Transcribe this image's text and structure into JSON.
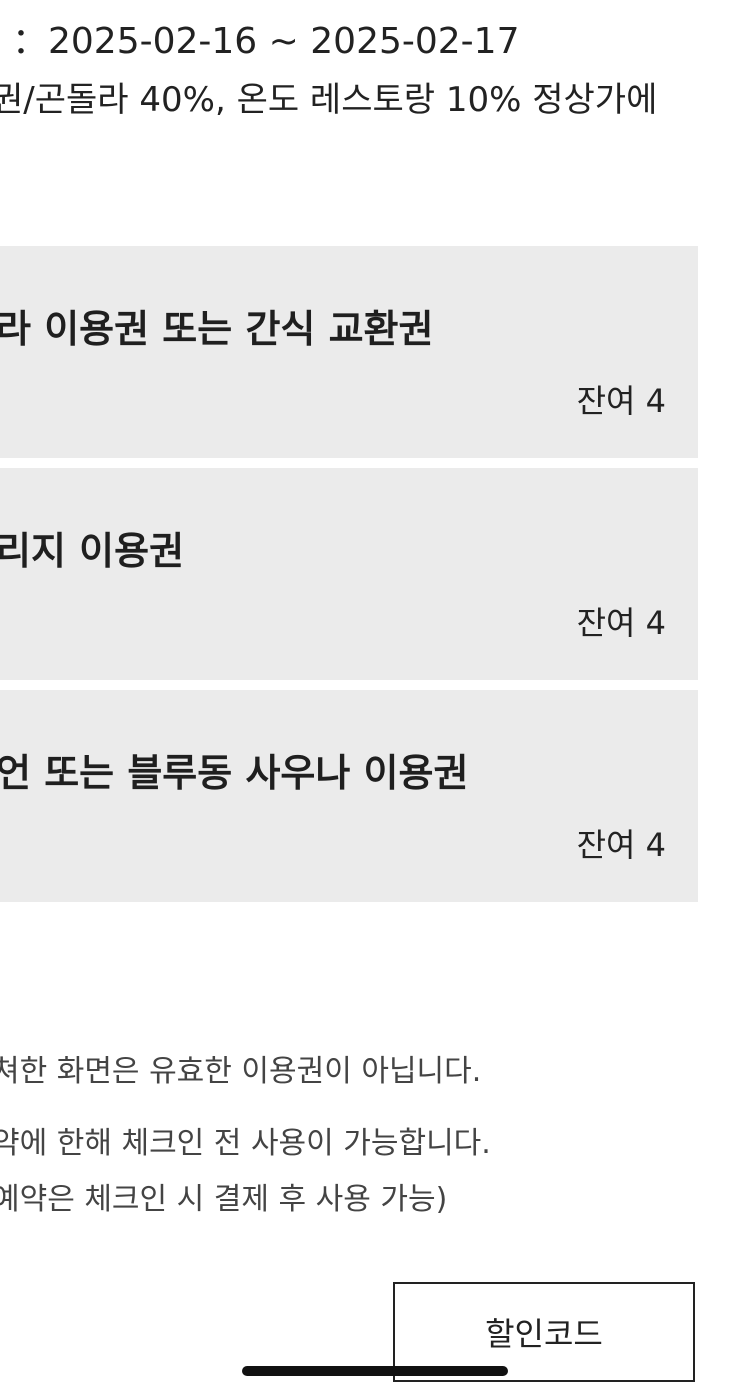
{
  "header": {
    "period": "：2025-02-16 ~ 2025-02-17",
    "benefit": "권/곤돌라 40%, 온도 레스토랑 10% 정상가에"
  },
  "vouchers": [
    {
      "title": "라 이용권 또는 간식 교환권",
      "remaining": "잔여 4"
    },
    {
      "title": "리지 이용권",
      "remaining": "잔여 4"
    },
    {
      "title": "언 또는 블루동 사우나 이용권",
      "remaining": "잔여 4"
    }
  ],
  "notices": [
    "쳐한 화면은 유효한 이용권이 아닙니다.",
    "약에 한해 체크인 전 사용이 가능합니다.",
    "예약은 체크인 시 결제 후 사용 가능)"
  ],
  "actions": {
    "discount_code_label": "할인코드"
  }
}
